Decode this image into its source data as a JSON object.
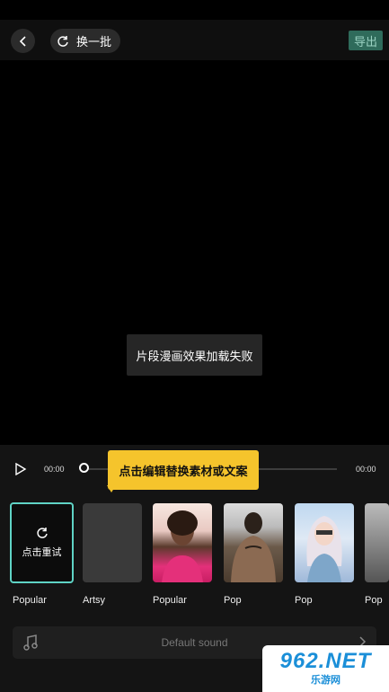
{
  "header": {
    "refresh_label": "换一批",
    "export_label": "导出"
  },
  "preview": {
    "toast": "片段漫画效果加载失败"
  },
  "player": {
    "time_start": "00:00",
    "time_end": "00:00",
    "progress": 0
  },
  "tooltip": "点击编辑替换素材或文案",
  "styles": [
    {
      "name": "Popular",
      "retry_label": "点击重试",
      "selected": true
    },
    {
      "name": "Artsy"
    },
    {
      "name": "Popular"
    },
    {
      "name": "Pop"
    },
    {
      "name": "Pop"
    },
    {
      "name": "Pop"
    }
  ],
  "sound": {
    "label": "Default sound"
  },
  "watermark": {
    "main": "962.NET",
    "sub": "乐游网"
  },
  "colors": {
    "accent": "#5fd3c5",
    "tooltip_bg": "#f5c42c",
    "export_bg": "#2f6b5b"
  }
}
